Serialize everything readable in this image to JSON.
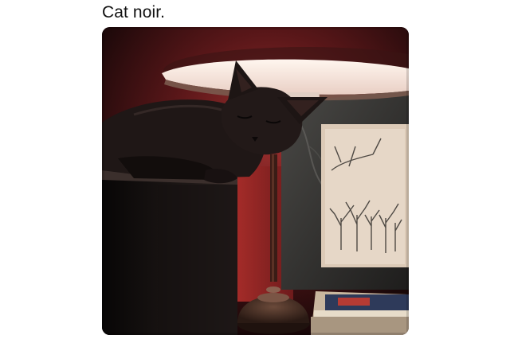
{
  "post": {
    "caption": "Cat noir.",
    "photo": {
      "subject": "black-cat-sleeping-next-to-lamp",
      "colors": {
        "wall_dark": "#2a0f12",
        "wall_red": "#8e1f22",
        "lamp_shade_glow": "#f6e6dc",
        "cat_fur": "#1d1514",
        "marble": "#3b3a38",
        "artwork_paper": "#d8c7b5"
      }
    }
  }
}
